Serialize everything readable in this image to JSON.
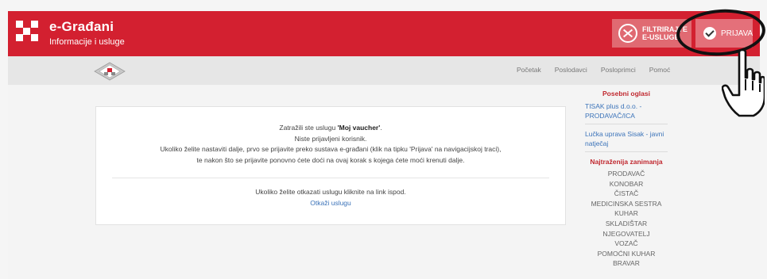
{
  "header": {
    "brand_name": "e-Građani",
    "brand_sub": "Informacije i usluge",
    "filter_line1": "FILTRIRAJTE",
    "filter_line2": "E-USLUGE",
    "login_label": "PRIJAVA"
  },
  "nav": {
    "links": [
      "Početak",
      "Poslodavci",
      "Posloprimci",
      "Pomoć"
    ]
  },
  "message": {
    "line1_prefix": "Zatražili ste uslugu ",
    "line1_service": "'Moj vaucher'",
    "line1_suffix": ".",
    "line2": "Niste prijavljeni korisnik.",
    "line3": "Ukoliko želite nastaviti dalje, prvo se prijavite preko sustava e-građani (klik na tipku 'Prijava' na navigacijskoj traci),",
    "line4": "te nakon što se prijavite ponovno ćete doći na ovaj korak s kojega ćete moći krenuti dalje.",
    "cancel_text": "Ukoliko želite otkazati uslugu kliknite na link ispod.",
    "cancel_link": "Otkaži uslugu"
  },
  "sidebar": {
    "special_title": "Posebni oglasi",
    "ads": [
      "TISAK plus d.o.o. - PRODAVAČ/ICA",
      "Lučka uprava Sisak - javni natječaj"
    ],
    "jobs_title": "Najtraženija zanimanja",
    "jobs": [
      "PRODAVAČ",
      "KONOBAR",
      "ČISTAČ",
      "MEDICINSKA SESTRA",
      "KUHAR",
      "SKLADIŠTAR",
      "NJEGOVATELJ",
      "VOZAČ",
      "POMOĆNI KUHAR",
      "BRAVAR"
    ]
  },
  "colors": {
    "brand_red": "#d32030",
    "link_blue": "#3b73b9",
    "title_red": "#c0282f"
  }
}
